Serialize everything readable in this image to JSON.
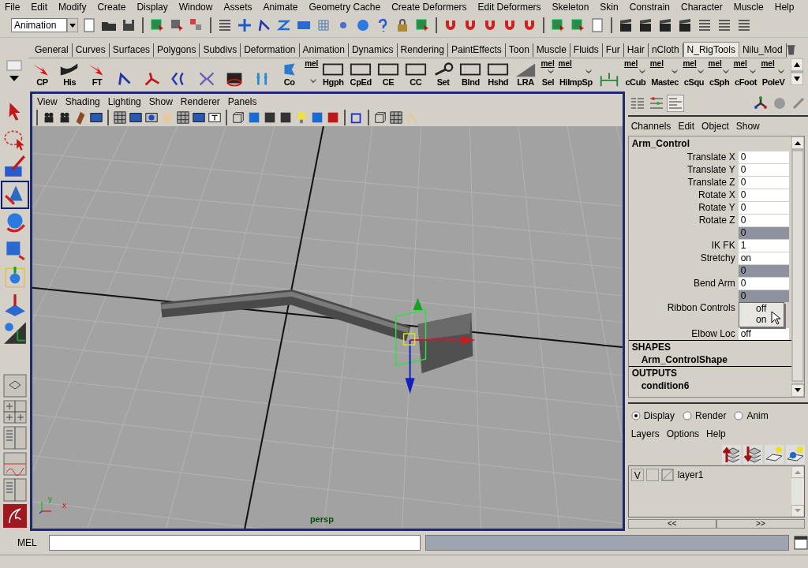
{
  "menu_bar": [
    "File",
    "Edit",
    "Modify",
    "Create",
    "Display",
    "Window",
    "Assets",
    "Animate",
    "Geometry Cache",
    "Create Deformers",
    "Edit Deformers",
    "Skeleton",
    "Skin",
    "Constrain",
    "Character",
    "Muscle",
    "Help"
  ],
  "mode_selector": {
    "value": "Animation"
  },
  "shelf_tabs": [
    {
      "label": "General",
      "selected": false
    },
    {
      "label": "Curves",
      "selected": false
    },
    {
      "label": "Surfaces",
      "selected": false
    },
    {
      "label": "Polygons",
      "selected": false
    },
    {
      "label": "Subdivs",
      "selected": false
    },
    {
      "label": "Deformation",
      "selected": false
    },
    {
      "label": "Animation",
      "selected": false
    },
    {
      "label": "Dynamics",
      "selected": false
    },
    {
      "label": "Rendering",
      "selected": false
    },
    {
      "label": "PaintEffects",
      "selected": false
    },
    {
      "label": "Toon",
      "selected": false
    },
    {
      "label": "Muscle",
      "selected": false
    },
    {
      "label": "Fluids",
      "selected": false
    },
    {
      "label": "Fur",
      "selected": false
    },
    {
      "label": "Hair",
      "selected": false
    },
    {
      "label": "nCloth",
      "selected": false
    },
    {
      "label": "N_RigTools",
      "selected": true
    },
    {
      "label": "Nilu_Mod",
      "selected": false
    }
  ],
  "shelf_buttons": [
    {
      "kind": "red-arrow",
      "label": "CP"
    },
    {
      "kind": "page-curl",
      "label": "His"
    },
    {
      "kind": "red-arrow",
      "label": "FT"
    },
    {
      "kind": "joint"
    },
    {
      "kind": "ik"
    },
    {
      "kind": "curve-joint"
    },
    {
      "kind": "chain"
    },
    {
      "kind": "device"
    },
    {
      "kind": "figures"
    },
    {
      "kind": "shape",
      "label": "Co"
    },
    {
      "kind": "mel",
      "tag": "mel"
    },
    {
      "kind": "frame",
      "label": "Hgph"
    },
    {
      "kind": "frame",
      "label": "CpEd"
    },
    {
      "kind": "frame",
      "label": "CE"
    },
    {
      "kind": "frame",
      "label": "CC"
    },
    {
      "kind": "key",
      "label": "Set"
    },
    {
      "kind": "frame",
      "label": "Blnd"
    },
    {
      "kind": "frame",
      "label": "Hshd"
    },
    {
      "kind": "ramp",
      "label": "LRA"
    },
    {
      "kind": "mel",
      "tag": "mel",
      "label": "Sel"
    },
    {
      "kind": "mel",
      "tag": "mel",
      "label": "HiImpSp"
    },
    {
      "kind": "bracket"
    },
    {
      "kind": "mel",
      "tag": "mel",
      "label": "cCub"
    },
    {
      "kind": "mel",
      "tag": "mel",
      "label": "Mastec"
    },
    {
      "kind": "mel",
      "tag": "mel",
      "label": "cSqu"
    },
    {
      "kind": "mel",
      "tag": "mel",
      "label": "cSph"
    },
    {
      "kind": "mel",
      "tag": "mel",
      "label": "cFoot"
    },
    {
      "kind": "mel",
      "tag": "mel",
      "label": "PoleV"
    }
  ],
  "viewport": {
    "menu": [
      "View",
      "Shading",
      "Lighting",
      "Show",
      "Renderer",
      "Panels"
    ],
    "camera_label": "persp",
    "axis_labels": [
      "y",
      "x"
    ]
  },
  "channel_box": {
    "menu": [
      "Channels",
      "Edit",
      "Object",
      "Show"
    ],
    "object": "Arm_Control",
    "attributes": [
      {
        "kind": "field",
        "label": "Translate X",
        "value": "0"
      },
      {
        "kind": "field",
        "label": "Translate Y",
        "value": "0"
      },
      {
        "kind": "field",
        "label": "Translate Z",
        "value": "0"
      },
      {
        "kind": "field",
        "label": "Rotate X",
        "value": "0"
      },
      {
        "kind": "field",
        "label": "Rotate Y",
        "value": "0"
      },
      {
        "kind": "field",
        "label": "Rotate Z",
        "value": "0"
      },
      {
        "kind": "locked",
        "value": "0"
      },
      {
        "kind": "field",
        "label": "IK FK",
        "value": "1"
      },
      {
        "kind": "field",
        "label": "Stretchy",
        "value": "on"
      },
      {
        "kind": "locked",
        "value": "0"
      },
      {
        "kind": "field",
        "label": "Bend Arm",
        "value": "0"
      },
      {
        "kind": "locked",
        "value": "0"
      },
      {
        "kind": "menu",
        "label": "Ribbon Controls",
        "options": [
          "off",
          "on"
        ]
      },
      {
        "kind": "field",
        "label": "Elbow Loc",
        "value": "off"
      }
    ],
    "sections": [
      {
        "heading": "SHAPES",
        "items": [
          "Arm_ControlShape"
        ]
      },
      {
        "heading": "OUTPUTS",
        "items": [
          "condition6"
        ]
      }
    ]
  },
  "layer_editor": {
    "modes": [
      {
        "label": "Display",
        "selected": true
      },
      {
        "label": "Render",
        "selected": false
      },
      {
        "label": "Anim",
        "selected": false
      }
    ],
    "menu": [
      "Layers",
      "Options",
      "Help"
    ],
    "layers": [
      {
        "visibility": "V",
        "name": "layer1"
      }
    ],
    "nav": [
      "<<",
      ">>"
    ]
  },
  "command_line": {
    "label": "MEL"
  }
}
